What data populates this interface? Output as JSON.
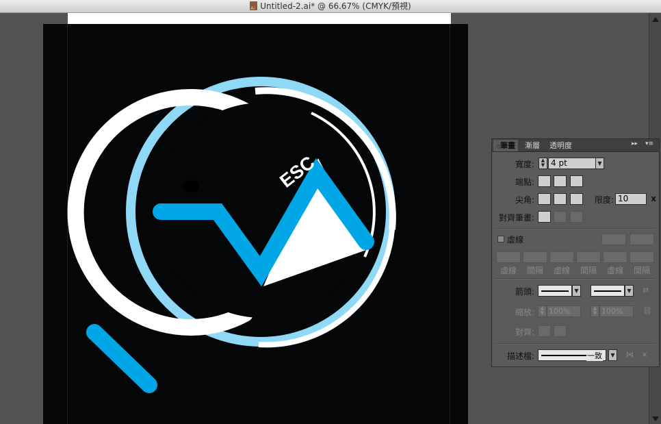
{
  "window": {
    "title": "Untitled-2.ai* @ 66.67% (CMYK/預視)"
  },
  "colors": {
    "artboard_bg": "#050608",
    "logo_blue": "#00a6e6",
    "logo_light_blue": "#8fd8f6",
    "logo_white": "#ffffff",
    "panel_bg": "#5b5b5b"
  },
  "artwork": {
    "logo_text": "ESC"
  },
  "stroke_panel": {
    "tabs": [
      "筆畫",
      "漸層",
      "透明度"
    ],
    "active_tab": "筆畫",
    "weight_label": "寬度:",
    "weight_value": "4 pt",
    "cap_label": "端點:",
    "corner_label": "尖角:",
    "limit_label": "限度:",
    "limit_value": "10",
    "limit_unit": "x",
    "align_label": "對齊筆畫:",
    "dashed_label": "虛線",
    "dash_labels": [
      "虛線",
      "間隔",
      "虛線",
      "間隔",
      "虛線",
      "間隔"
    ],
    "arrowheads_label": "箭頭:",
    "scale_label": "縮放:",
    "scale_start": "100%",
    "scale_end": "100%",
    "align_arrow_label": "對齊:",
    "profile_label": "描述檔:",
    "profile_value": "一致"
  }
}
